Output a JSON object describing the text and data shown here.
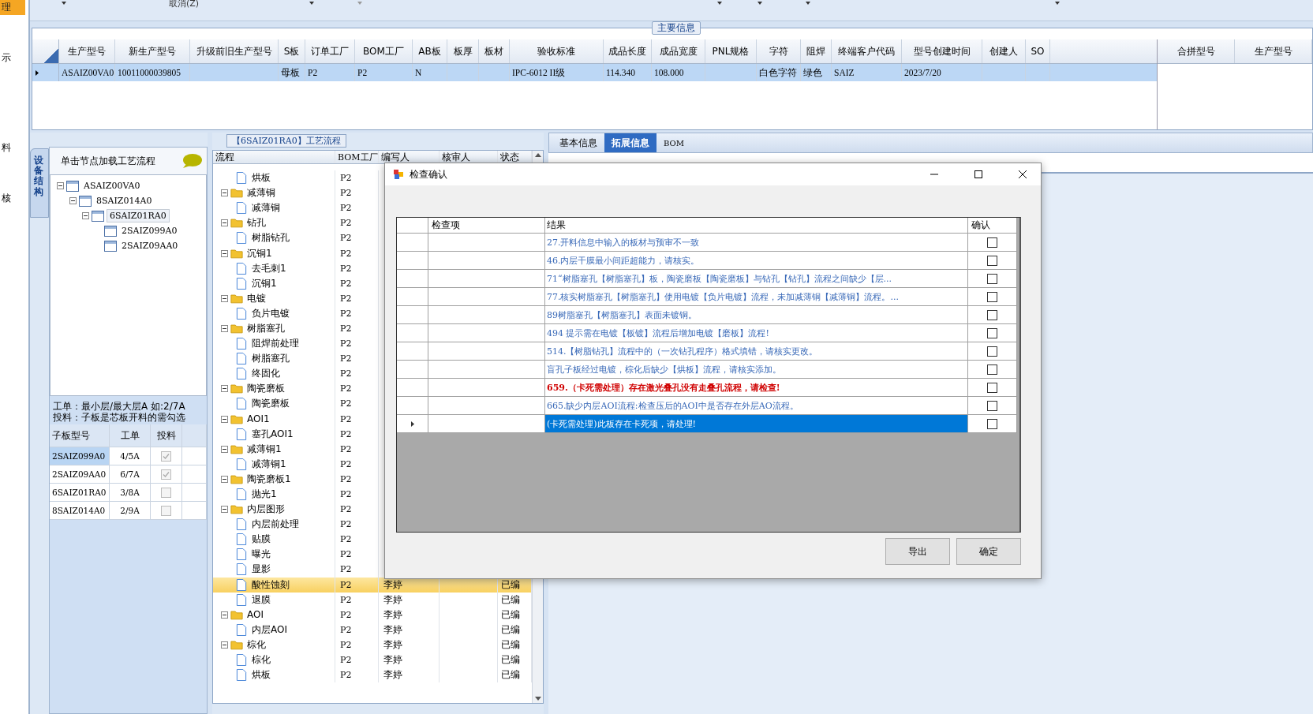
{
  "left_nav": [
    {
      "label": "理",
      "selected": true
    },
    {
      "label": "示",
      "selected": false
    },
    {
      "label": "料",
      "selected": false
    },
    {
      "label": "核",
      "selected": false
    }
  ],
  "toolbar": {
    "cancel_label": "取消(Z)"
  },
  "main_info": {
    "title": "主要信息",
    "columns": [
      "生产型号",
      "新生产型号",
      "升级前旧生产型号",
      "S板",
      "订单工厂",
      "BOM工厂",
      "AB板",
      "板厚",
      "板材",
      "验收标准",
      "成品长度",
      "成品宽度",
      "PNL规格",
      "字符",
      "阻焊",
      "终端客户代码",
      "型号创建时间",
      "创建人",
      "SO"
    ],
    "rows": [
      {
        "selected": true,
        "cells": [
          "ASAIZ00VA0",
          "10011000039805",
          null,
          "母板",
          "P2",
          "P2",
          "N",
          null,
          null,
          "IPC-6012 II级",
          "114.340",
          "108.000",
          null,
          "白色字符",
          "绿色",
          "SAIZ",
          "2023/7/20",
          null,
          null
        ]
      }
    ],
    "merge_columns": [
      "合拼型号",
      "生产型号"
    ]
  },
  "structure_panel": {
    "tab_label": "设备结构",
    "header": "单击节点加载工艺流程",
    "tree": [
      {
        "label": "ASAIZ00VA0",
        "selected": false,
        "children": [
          {
            "label": "8SAIZ014A0",
            "selected": false,
            "children": [
              {
                "label": "6SAIZ01RA0",
                "selected": true,
                "children": [
                  {
                    "label": "2SAIZ099A0",
                    "selected": false
                  },
                  {
                    "label": "2SAIZ09AA0",
                    "selected": false
                  }
                ]
              }
            ]
          }
        ]
      }
    ],
    "note": [
      "工单：最小层/最大层A 如:2/7A",
      "投料：子板是芯板开料的需勾选"
    ],
    "columns": [
      "子板型号",
      "工单",
      "投料"
    ],
    "rows": [
      {
        "board": "2SAIZ099A0",
        "order": "4/5A",
        "feed": true,
        "selected": true
      },
      {
        "board": "2SAIZ09AA0",
        "order": "6/7A",
        "feed": true,
        "selected": false
      },
      {
        "board": "6SAIZ01RA0",
        "order": "3/8A",
        "feed": false,
        "selected": false
      },
      {
        "board": "8SAIZ014A0",
        "order": "2/9A",
        "feed": false,
        "selected": false
      }
    ]
  },
  "process": {
    "title": "【6SAIZ01RA0】工艺流程",
    "columns": [
      "流程",
      "BOM工厂",
      "编写人",
      "核审人",
      "状态"
    ],
    "nodes": [
      {
        "children": [
          {
            "label": "烘板",
            "bom": "P2",
            "selected": false
          }
        ]
      },
      {
        "label": "减薄铜",
        "bom": "P2",
        "selected": false,
        "children": [
          {
            "label": "减薄铜",
            "bom": "P2",
            "selected": false
          }
        ]
      },
      {
        "label": "钻孔",
        "bom": "P2",
        "selected": false,
        "children": [
          {
            "label": "树脂钻孔",
            "bom": "P2",
            "selected": false
          }
        ]
      },
      {
        "label": "沉铜1",
        "bom": "P2",
        "selected": false,
        "children": [
          {
            "label": "去毛刺1",
            "bom": "P2",
            "selected": false
          },
          {
            "label": "沉铜1",
            "bom": "P2",
            "selected": false
          }
        ]
      },
      {
        "label": "电镀",
        "bom": "P2",
        "selected": false,
        "children": [
          {
            "label": "负片电镀",
            "bom": "P2",
            "selected": false
          }
        ]
      },
      {
        "label": "树脂塞孔",
        "bom": "P2",
        "selected": false,
        "children": [
          {
            "label": "阻焊前处理",
            "bom": "P2",
            "selected": false
          },
          {
            "label": "树脂塞孔",
            "bom": "P2",
            "selected": false
          },
          {
            "label": "终固化",
            "bom": "P2",
            "selected": false
          }
        ]
      },
      {
        "label": "陶瓷磨板",
        "bom": "P2",
        "selected": false,
        "children": [
          {
            "label": "陶瓷磨板",
            "bom": "P2",
            "selected": false
          }
        ]
      },
      {
        "label": "AOI1",
        "bom": "P2",
        "selected": false,
        "children": [
          {
            "label": "塞孔AOI1",
            "bom": "P2",
            "selected": false
          }
        ]
      },
      {
        "label": "减薄铜1",
        "bom": "P2",
        "selected": false,
        "children": [
          {
            "label": "减薄铜1",
            "bom": "P2",
            "selected": false
          }
        ]
      },
      {
        "label": "陶瓷磨板1",
        "bom": "P2",
        "selected": false,
        "children": [
          {
            "label": "抛光1",
            "bom": "P2",
            "selected": false
          }
        ]
      },
      {
        "label": "内层图形",
        "bom": "P2",
        "selected": false,
        "children": [
          {
            "label": "内层前处理",
            "bom": "P2",
            "selected": false
          },
          {
            "label": "贴膜",
            "bom": "P2",
            "selected": false
          },
          {
            "label": "曝光",
            "bom": "P2",
            "selected": false
          },
          {
            "label": "显影",
            "bom": "P2",
            "selected": false
          },
          {
            "label": "酸性蚀刻",
            "bom": "P2",
            "author": "李婷",
            "status": "已编",
            "selected": true
          },
          {
            "label": "退膜",
            "bom": "P2",
            "author": "李婷",
            "status": "已编",
            "selected": false
          }
        ]
      },
      {
        "label": "AOI",
        "bom": "P2",
        "author": "李婷",
        "status": "已编",
        "selected": false,
        "children": [
          {
            "label": "内层AOI",
            "bom": "P2",
            "author": "李婷",
            "status": "已编",
            "selected": false
          }
        ]
      },
      {
        "label": "棕化",
        "bom": "P2",
        "author": "李婷",
        "status": "已编",
        "selected": false,
        "children": [
          {
            "label": "棕化",
            "bom": "P2",
            "author": "李婷",
            "status": "已编",
            "selected": false
          },
          {
            "label": "烘板",
            "bom": "P2",
            "author": "李婷",
            "status": "已编",
            "selected": false
          }
        ]
      }
    ]
  },
  "detail_tabs": [
    {
      "label": "基本信息",
      "selected": false
    },
    {
      "label": "拓展信息",
      "selected": true
    },
    {
      "label": "BOM",
      "selected": false
    }
  ],
  "dialog": {
    "title": "检查确认",
    "columns": [
      "检查项",
      "结果",
      "确认"
    ],
    "rows": [
      {
        "result": "27.开料信息中输入的板材与预审不一致",
        "kind": "normal",
        "confirmed": false,
        "selected": false
      },
      {
        "result": "46.内层干膜最小间距超能力，请核实。",
        "kind": "normal",
        "confirmed": false,
        "selected": false
      },
      {
        "result": "71“树脂塞孔【树脂塞孔】板，陶瓷磨板【陶瓷磨板】与钻孔【钻孔】流程之间缺少【层...",
        "kind": "normal",
        "confirmed": false,
        "selected": false
      },
      {
        "result": "77.核实树脂塞孔【树脂塞孔】使用电镀【负片电镀】流程，未加减薄铜【减薄铜】流程。...",
        "kind": "normal",
        "confirmed": false,
        "selected": false
      },
      {
        "result": "89树脂塞孔【树脂塞孔】表面未镀铜。",
        "kind": "normal",
        "confirmed": false,
        "selected": false
      },
      {
        "result": "494 提示需在电镀【板镀】流程后增加电镀【磨板】流程!",
        "kind": "normal",
        "confirmed": false,
        "selected": false
      },
      {
        "result": "514.【树脂钻孔】流程中的（一次钻孔程序）格式填错，请核实更改。",
        "kind": "normal",
        "confirmed": false,
        "selected": false
      },
      {
        "result": "盲孔子板经过电镀，棕化后缺少【烘板】流程，请核实添加。",
        "kind": "normal",
        "confirmed": false,
        "selected": false
      },
      {
        "result": "659.（卡死需处理）存在激光叠孔没有走叠孔流程，请检查!",
        "kind": "critical",
        "confirmed": false,
        "selected": false
      },
      {
        "result": "665.缺少内层AOI流程:检查压后的AOI中是否存在外层AO流程。",
        "kind": "normal",
        "confirmed": false,
        "selected": false
      },
      {
        "result": "(卡死需处理)此板存在卡死项，请处理!",
        "kind": "normal",
        "confirmed": false,
        "selected": true
      }
    ],
    "buttons": [
      "导出",
      "确定"
    ]
  }
}
